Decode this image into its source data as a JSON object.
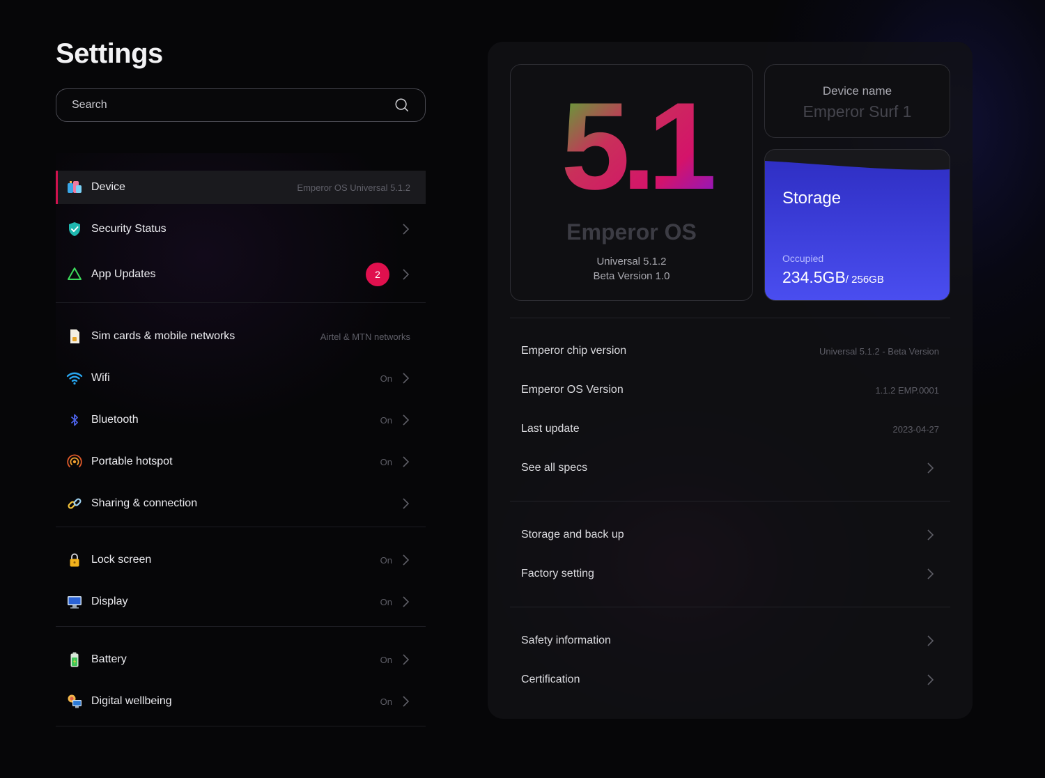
{
  "page": {
    "title": "Settings"
  },
  "search": {
    "placeholder": "Search"
  },
  "colors": {
    "accent": "#e0104e",
    "storage_fill": "#3b3fdc",
    "background": "#060608"
  },
  "sidebar": {
    "groups": [
      {
        "items": [
          {
            "label": "Device",
            "meta": "Emperor OS Universal 5.1.2",
            "icon": "device-icon",
            "active": true
          },
          {
            "label": "Security Status",
            "meta": "",
            "icon": "shield-icon"
          },
          {
            "label": "App Updates",
            "meta": "",
            "badge": "2",
            "icon": "app-updates-icon"
          }
        ]
      },
      {
        "items": [
          {
            "label": "Sim cards & mobile networks",
            "meta": "Airtel & MTN networks",
            "icon": "sim-card-icon"
          },
          {
            "label": "Wifi",
            "meta": "On",
            "icon": "wifi-icon"
          },
          {
            "label": "Bluetooth",
            "meta": "On",
            "icon": "bluetooth-icon"
          },
          {
            "label": "Portable hotspot",
            "meta": "On",
            "icon": "hotspot-icon"
          },
          {
            "label": "Sharing & connection",
            "meta": "",
            "icon": "link-icon"
          }
        ]
      },
      {
        "items": [
          {
            "label": "Lock screen",
            "meta": "On",
            "icon": "lock-icon"
          },
          {
            "label": "Display",
            "meta": "On",
            "icon": "display-icon"
          }
        ]
      },
      {
        "items": [
          {
            "label": "Battery",
            "meta": "On",
            "icon": "battery-icon"
          },
          {
            "label": "Digital wellbeing",
            "meta": "On",
            "icon": "wellbeing-icon"
          }
        ]
      }
    ]
  },
  "os_card": {
    "version_big": "5.1",
    "name": "Emperor OS",
    "version": "Universal 5.1.2",
    "beta": "Beta Version 1.0"
  },
  "device_name": {
    "label": "Device name",
    "value": "Emperor Surf 1"
  },
  "storage": {
    "title": "Storage",
    "occupied_label": "Occupied",
    "used": "234.5GB",
    "total": "/ 256GB",
    "used_fraction": 0.916
  },
  "specs": [
    {
      "label": "Emperor chip version",
      "value": "Universal 5.1.2 - Beta Version"
    },
    {
      "label": "Emperor OS Version",
      "value": "1.1.2 EMP.0001"
    },
    {
      "label": "Last update",
      "value": "2023-04-27"
    },
    {
      "label": "See all specs",
      "value": ""
    }
  ],
  "more": [
    {
      "label": "Storage and back up"
    },
    {
      "label": "Factory setting"
    }
  ],
  "info": [
    {
      "label": "Safety information"
    },
    {
      "label": "Certification"
    }
  ]
}
